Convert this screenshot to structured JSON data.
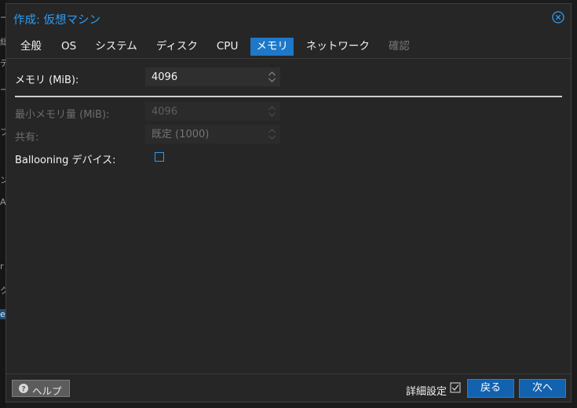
{
  "background_edge": [
    "ー",
    "総",
    "デ",
    "ー",
    "フ",
    "ン",
    "A",
    "r",
    "ク",
    "e"
  ],
  "dialog": {
    "title": "作成: 仮想マシン",
    "close_icon": "close-circle-icon"
  },
  "tabs": [
    {
      "label": "全般",
      "state": "normal"
    },
    {
      "label": "OS",
      "state": "normal"
    },
    {
      "label": "システム",
      "state": "normal"
    },
    {
      "label": "ディスク",
      "state": "normal"
    },
    {
      "label": "CPU",
      "state": "normal"
    },
    {
      "label": "メモリ",
      "state": "active"
    },
    {
      "label": "ネットワーク",
      "state": "normal"
    },
    {
      "label": "確認",
      "state": "disabled"
    }
  ],
  "form": {
    "memory": {
      "label": "メモリ (MiB):",
      "value": "4096"
    },
    "min_memory": {
      "label": "最小メモリ量 (MiB):",
      "value": "4096"
    },
    "shares": {
      "label": "共有:",
      "placeholder": "既定 (1000)"
    },
    "ballooning": {
      "label": "Ballooning デバイス:",
      "checked": false
    }
  },
  "footer": {
    "help_label": "ヘルプ",
    "advanced_label": "詳細設定",
    "advanced_checked": true,
    "back_label": "戻る",
    "next_label": "次へ"
  },
  "colors": {
    "accent": "#2e9cf0",
    "active_tab": "#1e78c7",
    "primary_button": "#1362b0",
    "dialog_bg": "#262626"
  }
}
